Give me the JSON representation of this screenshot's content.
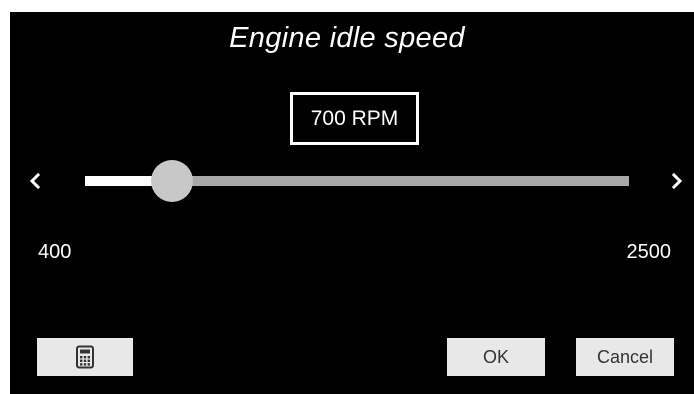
{
  "dialog": {
    "title": "Engine idle speed",
    "value_display": "700 RPM"
  },
  "slider": {
    "min": 400,
    "max": 2500,
    "value": 700,
    "min_label": "400",
    "max_label": "2500"
  },
  "icons": {
    "decrease": "chevron-left-icon",
    "increase": "chevron-right-icon",
    "keypad": "calculator-icon"
  },
  "buttons": {
    "ok_label": "OK",
    "cancel_label": "Cancel"
  },
  "colors": {
    "background": "#000000",
    "text": "#ffffff",
    "track_filled": "#ffffff",
    "track_empty": "#a9a9a9",
    "thumb": "#c8c8c8",
    "button_bg": "#e8e8e8",
    "button_text": "#333333"
  }
}
